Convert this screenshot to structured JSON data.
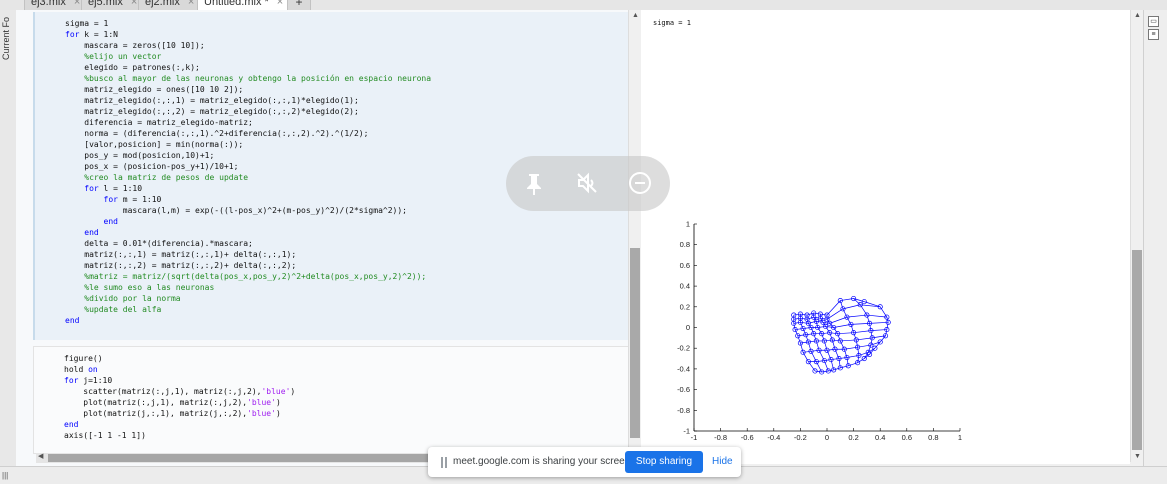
{
  "tabs": [
    {
      "label": "ej3.mlx",
      "active": false
    },
    {
      "label": "ej5.mlx",
      "active": false
    },
    {
      "label": "ej2.mlx",
      "active": false
    },
    {
      "label": "Untitled.mlx *",
      "active": true
    }
  ],
  "tab_add_label": "+",
  "tab_close_glyph": "×",
  "left_panel_label": "Current Fo",
  "code": {
    "cell1": [
      "sigma = 1",
      "for k = 1:N",
      "    mascara = zeros([10 10]);",
      "    %elijo un vector",
      "    elegido = patrones(:,k);",
      "    %busco al mayor de las neuronas y obtengo la posición en espacio neurona",
      "    matriz_elegido = ones([10 10 2]);",
      "    matriz_elegido(:,:,1) = matriz_elegido(:,:,1)*elegido(1);",
      "    matriz_elegido(:,:,2) = matriz_elegido(:,:,2)*elegido(2);",
      "    diferencia = matriz_elegido-matriz;",
      "    norma = (diferencia(:,:,1).^2+diferencia(:,:,2).^2).^(1/2);",
      "    [valor,posicion] = min(norma(:));",
      "    pos_y = mod(posicion,10)+1;",
      "    pos_x = (posicion-pos_y+1)/10+1;",
      "    %creo la matriz de pesos de update",
      "    for l = 1:10",
      "        for m = 1:10",
      "            mascara(l,m) = exp(-((l-pos_x)^2+(m-pos_y)^2)/(2*sigma^2));",
      "        end",
      "    end",
      "    delta = 0.01*(diferencia).*mascara;",
      "    matriz(:,:,1) = matriz(:,:,1)+ delta(:,:,1);",
      "    matriz(:,:,2) = matriz(:,:,2)+ delta(:,:,2);",
      "    %matriz = matriz/(sqrt(delta(pos_x,pos_y,2)^2+delta(pos_x,pos_y,2)^2));",
      "    %le sumo eso a las neuronas",
      "    %divido por la norma",
      "    %update del alfa",
      "end"
    ],
    "cell2": [
      "figure()",
      "hold on",
      "for j=1:10",
      "    scatter(matriz(:,j,1), matriz(:,j,2),'blue')",
      "    plot(matriz(:,j,1), matriz(:,j,2),'blue')",
      "    plot(matriz(j,:,1), matriz(j,:,2),'blue')",
      "end",
      "axis([-1 1 -1 1])"
    ]
  },
  "output_text": "sigma = 1",
  "chart_data": {
    "type": "scatter",
    "title": "",
    "xlabel": "",
    "ylabel": "",
    "xlim": [
      -1,
      1
    ],
    "ylim": [
      -1,
      1
    ],
    "xticks": [
      "-1",
      "-0.8",
      "-0.6",
      "-0.4",
      "-0.2",
      "0",
      "0.2",
      "0.4",
      "0.6",
      "0.8",
      "1"
    ],
    "yticks": [
      "-1",
      "-0.8",
      "-0.6",
      "-0.4",
      "-0.2",
      "0",
      "0.2",
      "0.4",
      "0.6",
      "0.8",
      "1"
    ],
    "grid": false,
    "color": "#0000ff",
    "series": [
      {
        "x": [
          -0.25,
          -0.2,
          -0.15,
          -0.1,
          -0.05,
          0.0,
          0.1,
          0.2,
          0.28
        ],
        "y": [
          0.12,
          0.13,
          0.12,
          0.14,
          0.13,
          0.12,
          0.26,
          0.28,
          0.25
        ]
      },
      {
        "x": [
          -0.25,
          -0.2,
          -0.15,
          -0.1,
          -0.05,
          0.0,
          0.12,
          0.25,
          0.4
        ],
        "y": [
          0.08,
          0.09,
          0.08,
          0.1,
          0.09,
          0.08,
          0.18,
          0.22,
          0.2
        ]
      },
      {
        "x": [
          -0.25,
          -0.2,
          -0.14,
          -0.08,
          -0.03,
          0.02,
          0.15,
          0.3,
          0.45
        ],
        "y": [
          0.04,
          0.05,
          0.04,
          0.06,
          0.05,
          0.04,
          0.1,
          0.12,
          0.1
        ]
      },
      {
        "x": [
          -0.24,
          -0.18,
          -0.12,
          -0.07,
          -0.01,
          0.05,
          0.18,
          0.32,
          0.46
        ],
        "y": [
          -0.02,
          -0.01,
          0.0,
          0.0,
          0.01,
          0.0,
          0.03,
          0.04,
          0.05
        ]
      },
      {
        "x": [
          -0.22,
          -0.16,
          -0.1,
          -0.04,
          0.02,
          0.08,
          0.2,
          0.33,
          0.45
        ],
        "y": [
          -0.08,
          -0.07,
          -0.06,
          -0.06,
          -0.05,
          -0.06,
          -0.05,
          -0.03,
          -0.02
        ]
      },
      {
        "x": [
          -0.2,
          -0.14,
          -0.08,
          -0.02,
          0.04,
          0.1,
          0.22,
          0.34,
          0.44
        ],
        "y": [
          -0.15,
          -0.14,
          -0.13,
          -0.13,
          -0.12,
          -0.13,
          -0.12,
          -0.1,
          -0.08
        ]
      },
      {
        "x": [
          -0.18,
          -0.12,
          -0.06,
          0.0,
          0.06,
          0.13,
          0.23,
          0.33,
          0.4
        ],
        "y": [
          -0.24,
          -0.23,
          -0.22,
          -0.22,
          -0.21,
          -0.21,
          -0.19,
          -0.17,
          -0.14
        ]
      },
      {
        "x": [
          -0.14,
          -0.08,
          -0.02,
          0.03,
          0.09,
          0.15,
          0.24,
          0.31,
          0.36
        ],
        "y": [
          -0.33,
          -0.33,
          -0.32,
          -0.31,
          -0.3,
          -0.29,
          -0.27,
          -0.24,
          -0.2
        ]
      },
      {
        "x": [
          -0.09,
          -0.04,
          0.01,
          0.05,
          0.1,
          0.16,
          0.23,
          0.28,
          0.32
        ],
        "y": [
          -0.42,
          -0.43,
          -0.42,
          -0.41,
          -0.39,
          -0.37,
          -0.34,
          -0.3,
          -0.26
        ]
      }
    ]
  },
  "share_bar": {
    "message": "meet.google.com is sharing your screen.",
    "stop_label": "Stop sharing",
    "hide_label": "Hide",
    "stop_color": "#1a73e8"
  },
  "overlay_icons": [
    "pin-icon",
    "speaker-muted-icon",
    "remove-circle-icon"
  ],
  "right_strip_icons": [
    "expand-icon",
    "collapse-icon"
  ],
  "status_indicator": "|||"
}
